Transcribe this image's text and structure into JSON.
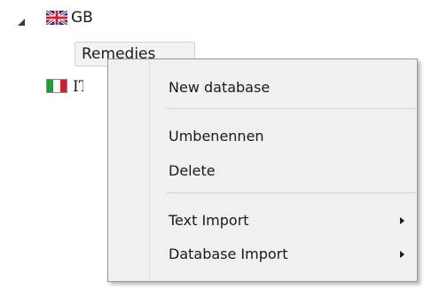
{
  "tree": {
    "items": [
      {
        "label": "GB",
        "flag": "uk-flag-icon",
        "expanded": true,
        "children": [
          {
            "label": "Remedies",
            "selected": true
          }
        ]
      },
      {
        "label": "IT",
        "flag": "italy-flag-icon",
        "expanded": false
      }
    ]
  },
  "context_menu": {
    "items": [
      {
        "label": "New database"
      },
      {
        "label": "Umbenennen"
      },
      {
        "label": "Delete"
      },
      {
        "label": "Text Import",
        "submenu": true
      },
      {
        "label": "Database Import",
        "submenu": true
      }
    ]
  },
  "colors": {
    "menu_background": "#f0f0f0",
    "menu_border": "#979797",
    "selected_item_background": "#f3f3f3",
    "text": "#1a1a1a"
  }
}
